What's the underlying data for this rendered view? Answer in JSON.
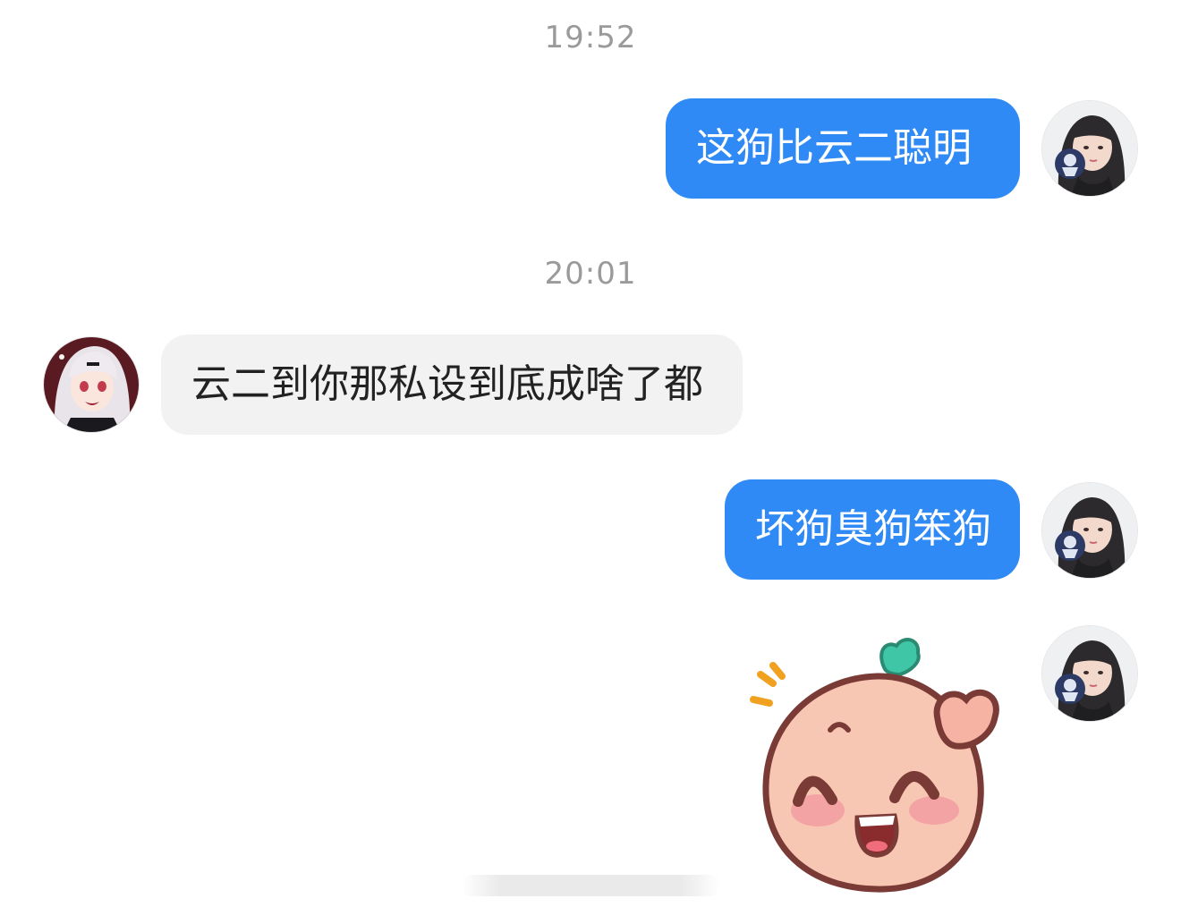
{
  "chat": {
    "timestamps": [
      "19:52",
      "20:01"
    ],
    "messages": [
      {
        "side": "right",
        "text": "这狗比云二聪明"
      },
      {
        "side": "left",
        "text": "云二到你那私设到底成啥了都"
      },
      {
        "side": "right",
        "text": "坏狗臭狗笨狗"
      },
      {
        "side": "right",
        "sticker": "peach-waving-sticker"
      }
    ]
  },
  "colors": {
    "outgoing_bubble": "#2f8af5",
    "incoming_bubble": "#f2f2f2",
    "timestamp_text": "#9a9a9a"
  },
  "icons": {
    "self_avatar": "self-avatar-photo",
    "contact_avatar": "contact-avatar-anime"
  }
}
